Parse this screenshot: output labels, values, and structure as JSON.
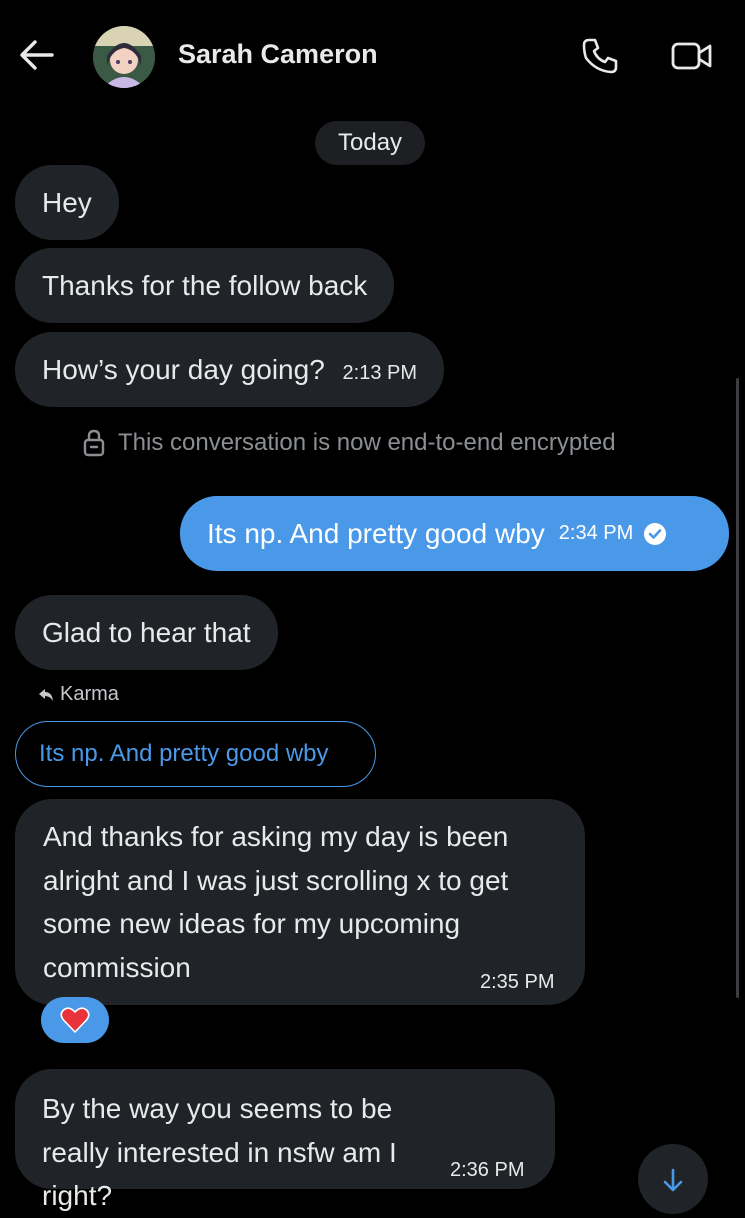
{
  "header": {
    "contact_name": "Sarah Cameron",
    "back_icon": "arrow-left-icon",
    "call_icon": "phone-icon",
    "video_icon": "video-camera-icon"
  },
  "date_separator": "Today",
  "messages": [
    {
      "direction": "in",
      "text": "Hey",
      "time": ""
    },
    {
      "direction": "in",
      "text": "Thanks for the follow back",
      "time": ""
    },
    {
      "direction": "in",
      "text": "How’s your day going?",
      "time": "2:13 PM"
    },
    {
      "direction": "out",
      "text": "Its np. And pretty good wby",
      "time": "2:34 PM",
      "status_icon": "check-circle-icon"
    },
    {
      "direction": "in",
      "text": "Glad to hear that",
      "time": ""
    },
    {
      "direction": "in",
      "text": "And thanks for asking my day is been alright and I was just scrolling x to get some new ideas for my upcoming commission",
      "time": "2:35 PM"
    },
    {
      "direction": "in",
      "text": "By the way you seems to be really interested in nsfw am I right?",
      "time": "2:36 PM"
    }
  ],
  "encryption_notice": "This conversation is now end-to-end encrypted",
  "reply": {
    "label": "Karma",
    "quoted_text": "Its np. And pretty good wby"
  },
  "reaction": {
    "emoji": "❤️"
  },
  "colors": {
    "background": "#000000",
    "bubble_in": "#202327",
    "bubble_out": "#4a99e9",
    "accent": "#4a99e9"
  }
}
